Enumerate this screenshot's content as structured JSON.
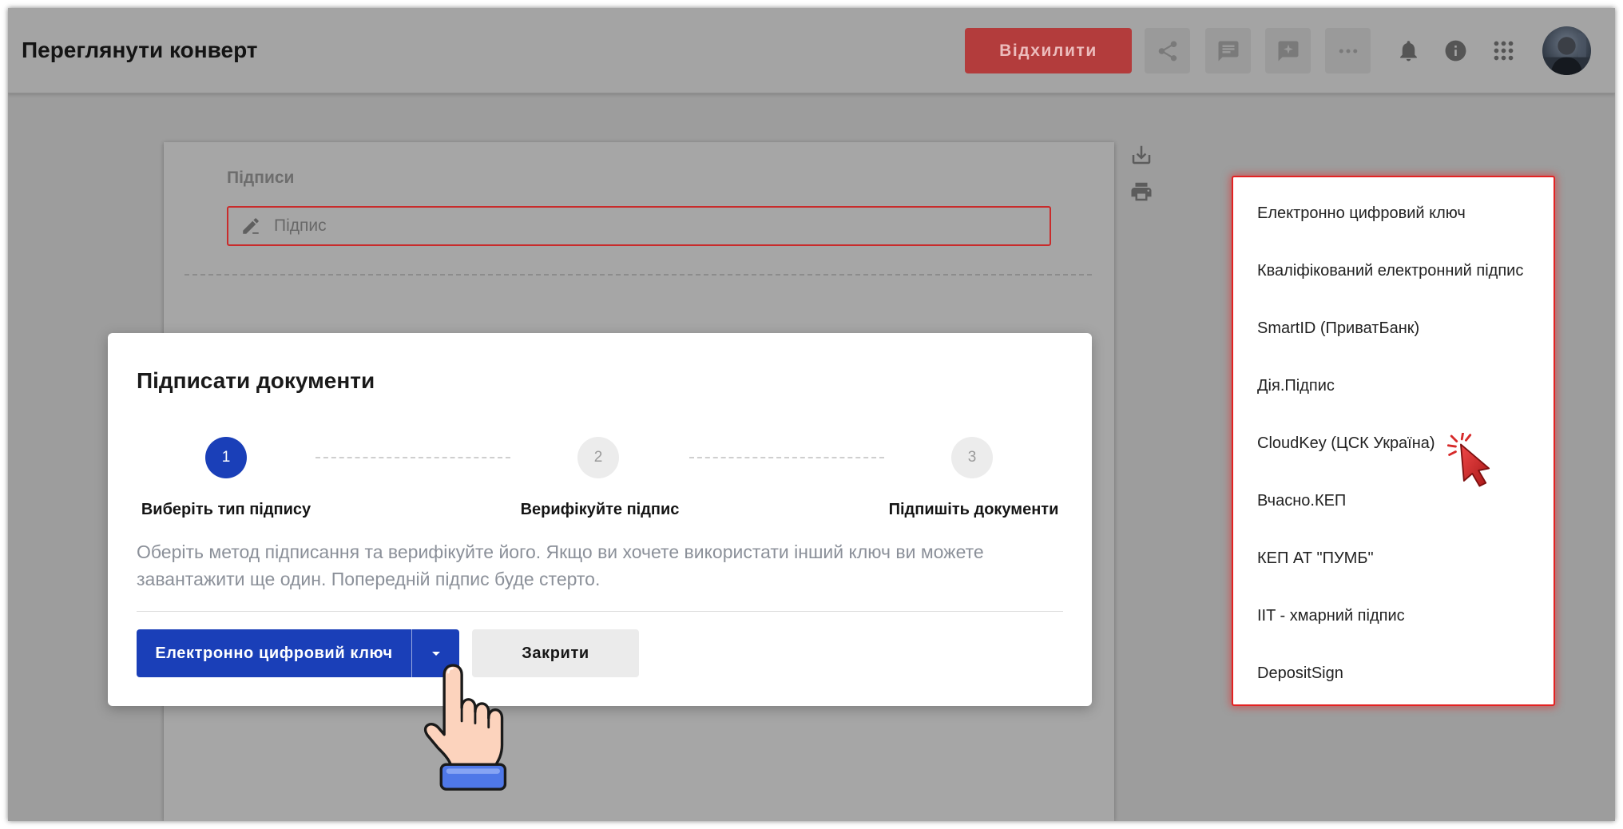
{
  "header": {
    "title": "Переглянути конверт",
    "reject_label": "Відхилити"
  },
  "document": {
    "section_label": "Підписи",
    "signature_placeholder": "Підпис"
  },
  "modal": {
    "title": "Підписати документи",
    "steps": [
      {
        "number": "1",
        "label": "Виберіть тип підпису",
        "active": true
      },
      {
        "number": "2",
        "label": "Верифікуйте підпис",
        "active": false
      },
      {
        "number": "3",
        "label": "Підпишіть документи",
        "active": false
      }
    ],
    "description": "Оберіть метод підписання та верифікуйте його. Якщо ви хочете використати інший ключ ви можете завантажити ще один. Попередній підпис буде стерто.",
    "primary_button_label": "Електронно цифровий ключ",
    "close_button_label": "Закрити"
  },
  "signature_menu": {
    "items": [
      "Електронно цифровий ключ",
      "Кваліфікований електронний підпис",
      "SmartID (ПриватБанк)",
      "Дія.Підпис",
      "CloudKey (ЦСК Україна)",
      "Вчасно.КЕП",
      "КЕП АТ \"ПУМБ\"",
      "IIT - хмарний підпис",
      "DepositSign"
    ]
  },
  "icons": {
    "header_actions": [
      "share-icon",
      "comment-icon",
      "add-comment-icon",
      "more-icon"
    ],
    "header_utilities": [
      "bell-icon",
      "info-icon",
      "apps-icon"
    ],
    "document_side": [
      "download-icon",
      "print-icon"
    ],
    "signature_field": "pen-icon",
    "split_toggle": "chevron-down-icon",
    "annotations": [
      "hand-pointer-icon",
      "cursor-click-icon"
    ]
  },
  "colors": {
    "primary": "#1a3fb8",
    "reject": "#b33c3c",
    "highlight": "#e32222"
  }
}
